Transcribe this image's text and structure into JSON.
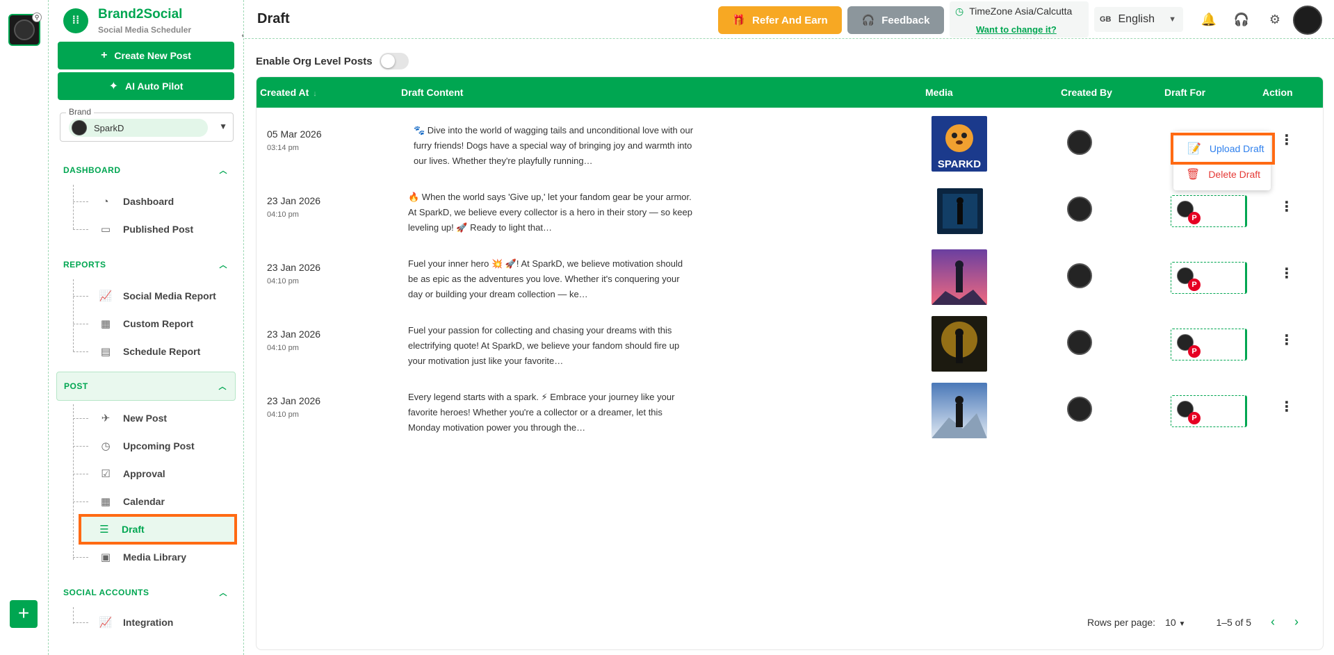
{
  "brand": {
    "name": "Brand2Social",
    "subtitle": "Social Media Scheduler"
  },
  "sidebar": {
    "create_new_post": "Create New Post",
    "ai_auto_pilot": "AI Auto Pilot",
    "brand_label": "Brand",
    "brand_value": "SparkD",
    "sections": {
      "dashboard": "DASHBOARD",
      "reports": "REPORTS",
      "post": "POST",
      "social_accounts": "SOCIAL ACCOUNTS"
    },
    "items": {
      "dashboard": "Dashboard",
      "published_post": "Published Post",
      "social_media_report": "Social Media Report",
      "custom_report": "Custom Report",
      "schedule_report": "Schedule Report",
      "new_post": "New Post",
      "upcoming_post": "Upcoming Post",
      "approval": "Approval",
      "calendar": "Calendar",
      "draft": "Draft",
      "media_library": "Media Library",
      "integration": "Integration"
    }
  },
  "header": {
    "title": "Draft",
    "refer_and_earn": "Refer And Earn",
    "feedback": "Feedback",
    "timezone": "TimeZone Asia/Calcutta",
    "timezone_change": "Want to change it?",
    "language_flag": "GB",
    "language": "English"
  },
  "main": {
    "org_level_label": "Enable Org Level Posts",
    "columns": {
      "created_at": "Created At",
      "draft_content": "Draft Content",
      "media": "Media",
      "created_by": "Created By",
      "draft_for": "Draft For",
      "action": "Action"
    },
    "rows": [
      {
        "date": "05 Mar 2026",
        "time": "03:14 pm",
        "content": "🐾 Dive into the world of wagging tails and unconditional love with our furry friends! Dogs have a special way of bringing joy and warmth into our lives. Whether they're playfully running…"
      },
      {
        "date": "23 Jan 2026",
        "time": "04:10 pm",
        "content": "🔥 When the world says 'Give up,' let your fandom gear be your armor. At SparkD, we believe every collector is a hero in their story — so keep leveling up! 🚀 Ready to light that…"
      },
      {
        "date": "23 Jan 2026",
        "time": "04:10 pm",
        "content": "Fuel your inner hero 💥 🚀! At SparkD, we believe motivation should be as epic as the adventures you love. Whether it's conquering your day or building your dream collection — ke…"
      },
      {
        "date": "23 Jan 2026",
        "time": "04:10 pm",
        "content": "Fuel your passion for collecting and chasing your dreams with this electrifying quote! At SparkD, we believe your fandom should fire up your motivation just like your favorite…"
      },
      {
        "date": "23 Jan 2026",
        "time": "04:10 pm",
        "content": "Every legend starts with a spark. ⚡ Embrace your journey like your favorite heroes! Whether you're a collector or a dreamer, let this Monday motivation power you through the…"
      }
    ],
    "media_text": "SPARKD",
    "action_menu": {
      "upload": "Upload Draft",
      "delete": "Delete Draft"
    },
    "pagination": {
      "rows_per_page_label": "Rows per page:",
      "rows_per_page": "10",
      "range": "1–5 of 5"
    }
  },
  "colors": {
    "accent": "#00a651",
    "refer": "#f7a823",
    "feedback": "#8c969c",
    "highlight": "#ff6a13",
    "upload": "#2f80ed",
    "delete": "#e53935"
  }
}
